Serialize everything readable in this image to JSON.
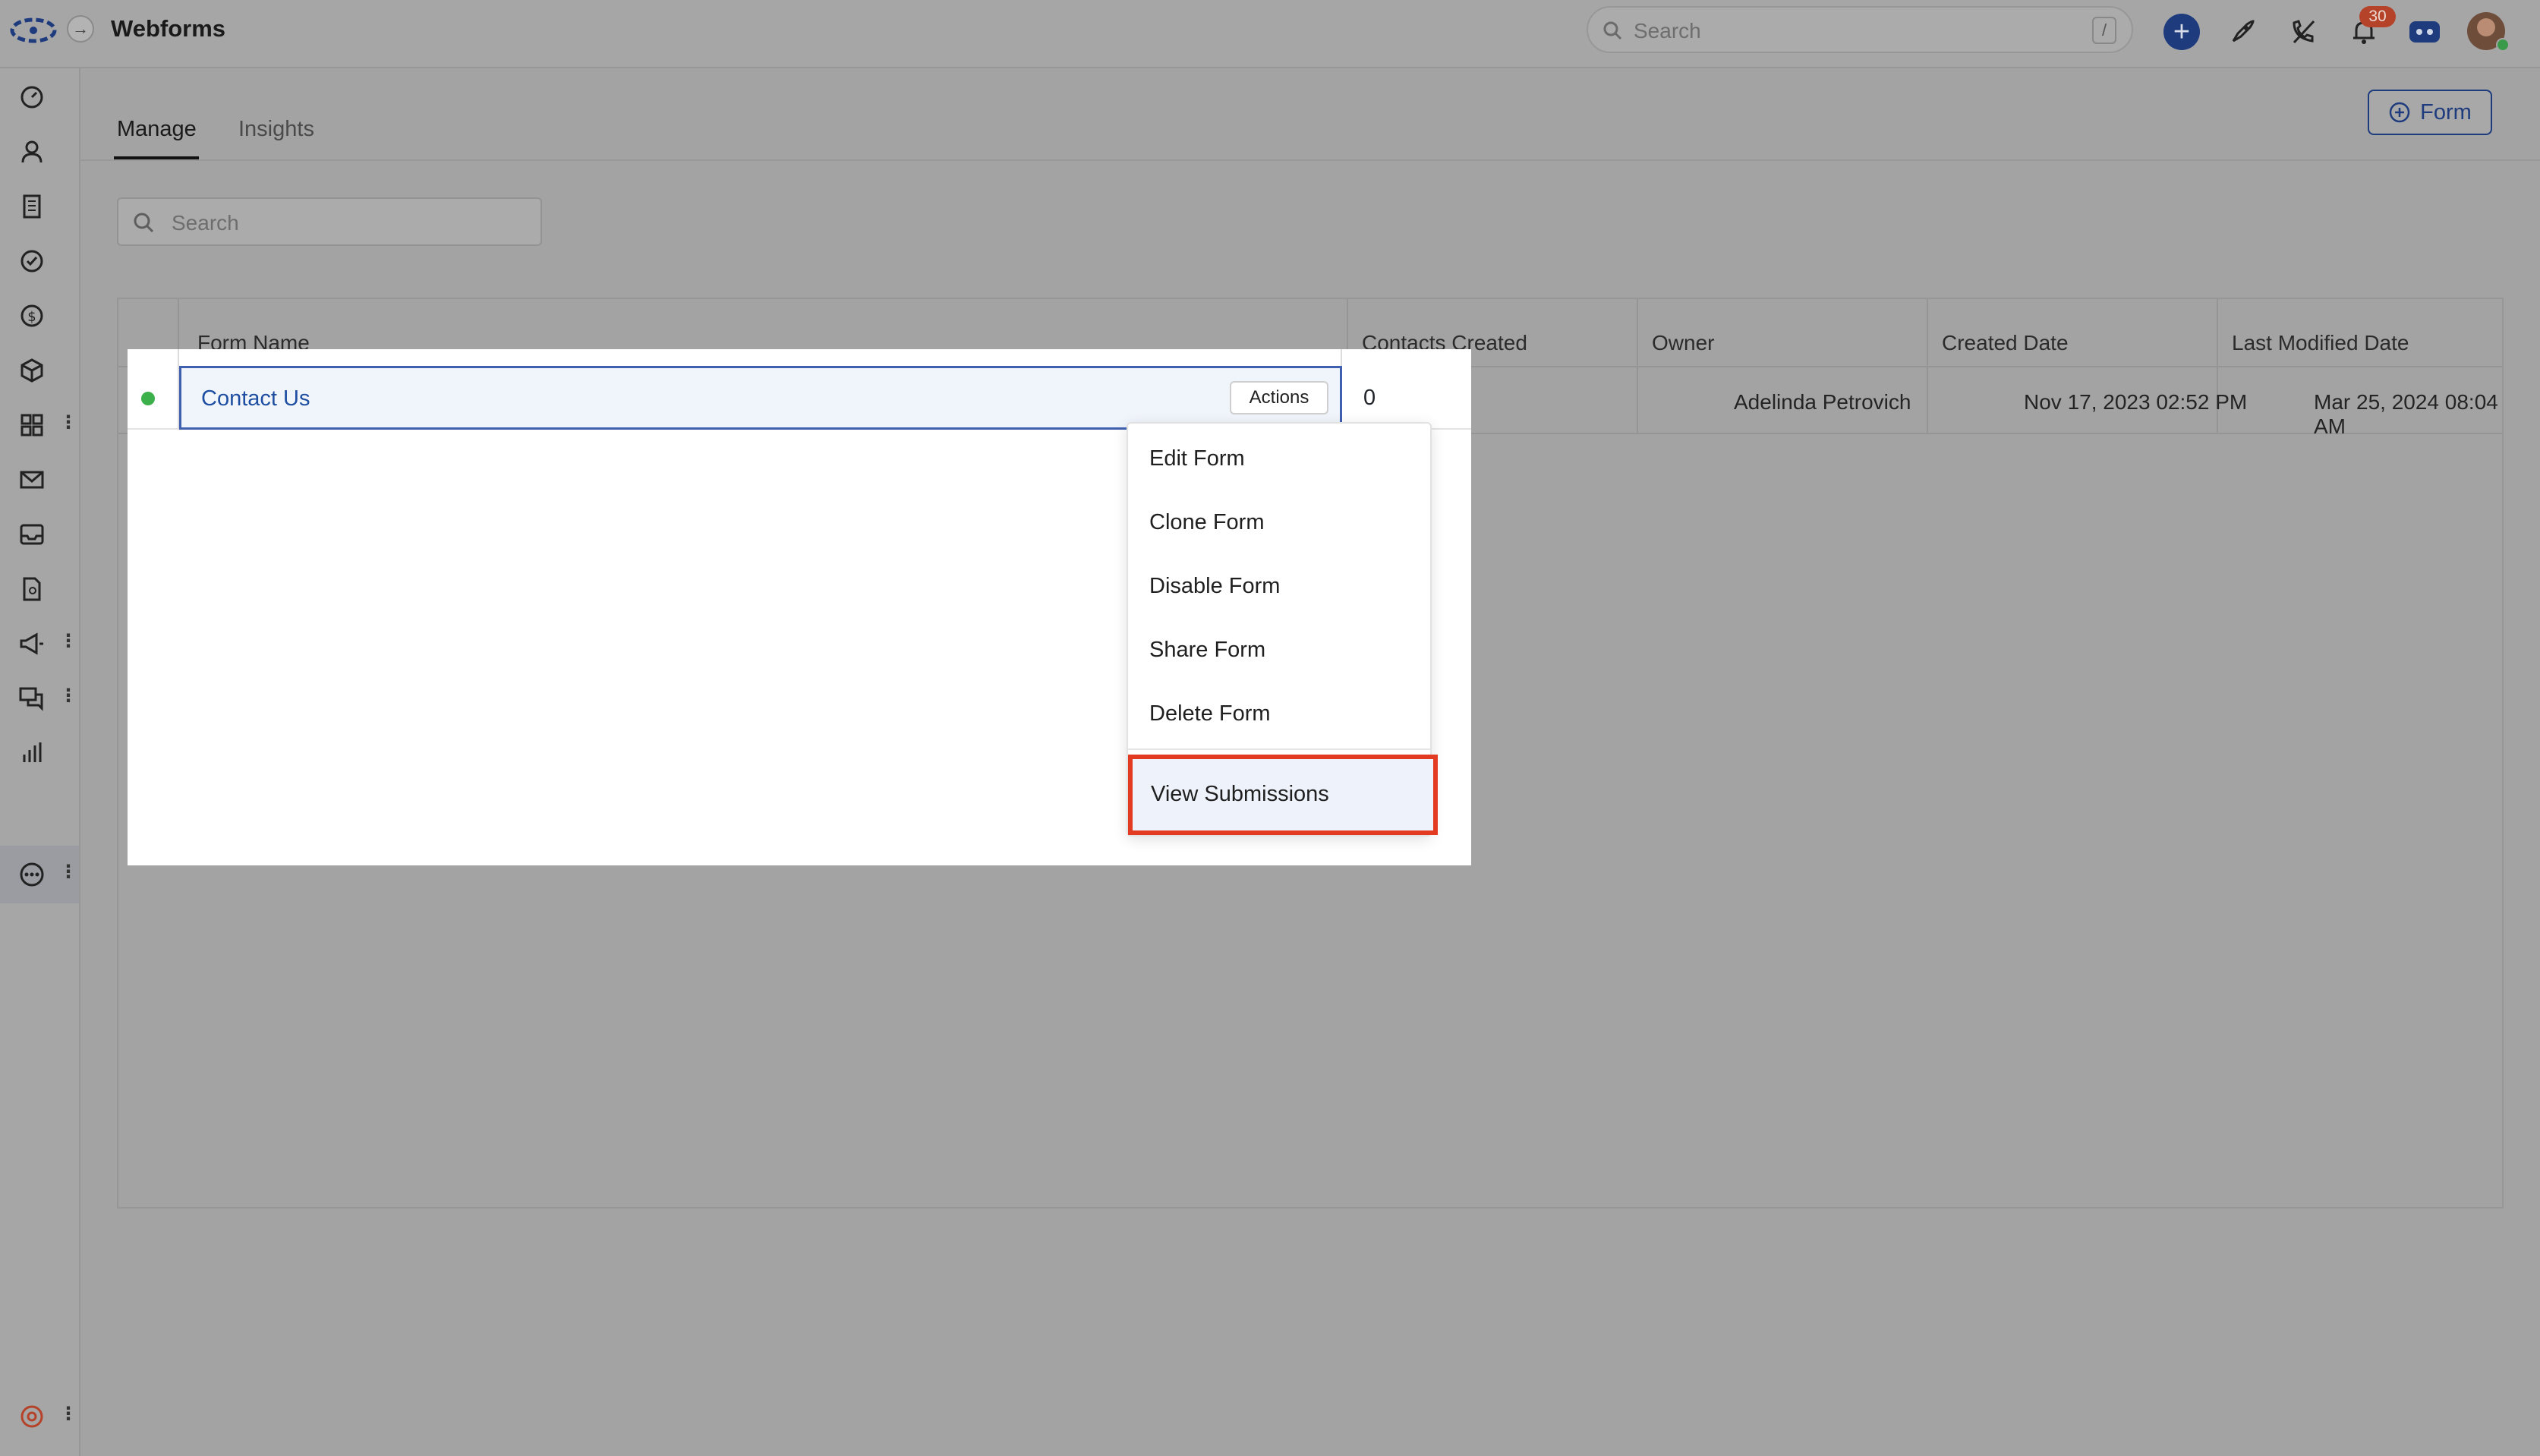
{
  "header": {
    "title": "Webforms",
    "search_placeholder": "Search",
    "search_shortcut": "/",
    "notification_count": "30"
  },
  "tabs": [
    {
      "label": "Manage",
      "active": true
    },
    {
      "label": "Insights",
      "active": false
    }
  ],
  "toolbar": {
    "new_form_label": "Form"
  },
  "page_search": {
    "placeholder": "Search"
  },
  "table": {
    "columns": [
      "Form Name",
      "Contacts Created",
      "Owner",
      "Created Date",
      "Last Modified Date"
    ],
    "rows": [
      {
        "status": "active",
        "form_name": "Contact Us",
        "contacts_created": "0",
        "owner": "Adelinda Petrovich",
        "created_date": "Nov 17, 2023 02:52 PM",
        "last_modified_date": "Mar 25, 2024 08:04 AM",
        "actions_label": "Actions"
      }
    ]
  },
  "actions_menu": {
    "items": [
      "Edit Form",
      "Clone Form",
      "Disable Form",
      "Share Form",
      "Delete Form"
    ],
    "highlighted_item": "View Submissions"
  },
  "colors": {
    "brand": "#1d3b7d",
    "highlight_border": "#e23b22",
    "status_active": "#3cb04b",
    "link": "#1d4ea1"
  },
  "icons": {
    "sidebar": [
      "dashboard-icon",
      "contacts-icon",
      "accounts-icon",
      "tasks-icon",
      "deals-icon",
      "products-icon",
      "apps-icon",
      "email-icon",
      "inbox-icon",
      "documents-icon",
      "campaigns-icon",
      "chat-icon",
      "reports-icon",
      "more-icon",
      "settings-icon"
    ]
  }
}
